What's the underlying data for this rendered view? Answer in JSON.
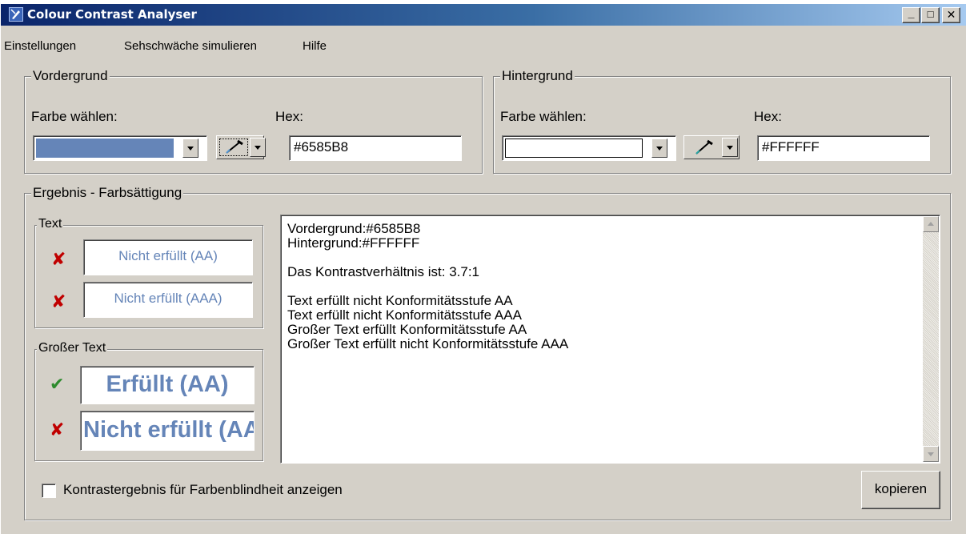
{
  "window": {
    "title": "Colour Contrast Analyser",
    "controls": {
      "minimize": "_",
      "maximize": "□",
      "close": "✕"
    }
  },
  "menu": [
    "Einstellungen",
    "Sehschwäche simulieren",
    "Hilfe"
  ],
  "foreground": {
    "group_label": "Vordergrund",
    "choose_label": "Farbe wählen:",
    "hex_label": "Hex:",
    "hex_value": "#6585B8",
    "swatch_color": "#6585b8",
    "picker_icon": "eyedropper-icon"
  },
  "background": {
    "group_label": "Hintergrund",
    "choose_label": "Farbe wählen:",
    "hex_label": "Hex:",
    "hex_value": "#FFFFFF",
    "swatch_color": "#ffffff",
    "picker_icon": "eyedropper-icon"
  },
  "result": {
    "group_label": "Ergebnis - Farbsättigung",
    "text_group": {
      "label": "Text",
      "items": [
        {
          "status": "fail",
          "icon": "cross-icon",
          "text": "Nicht erfüllt (AA)"
        },
        {
          "status": "fail",
          "icon": "cross-icon",
          "text": "Nicht erfüllt (AAA)"
        }
      ]
    },
    "large_text_group": {
      "label": "Großer Text",
      "items": [
        {
          "status": "pass",
          "icon": "checkmark-icon",
          "text": "Erfüllt (AA)"
        },
        {
          "status": "fail",
          "icon": "cross-icon",
          "text": "Nicht erfüllt (AAA)"
        }
      ]
    },
    "details": [
      "Vordergrund:#6585B8",
      "Hintergrund:#FFFFFF",
      "",
      "Das Kontrastverhältnis ist: 3.7:1",
      "",
      "Text erfüllt nicht Konformitätsstufe AA",
      "Text erfüllt nicht Konformitätsstufe AAA",
      "Großer Text erfüllt Konformitätsstufe AA",
      "Großer Text erfüllt nicht Konformitätsstufe AAA"
    ],
    "colorblind_checkbox_label": "Kontrastergebnis für Farbenblindheit anzeigen",
    "colorblind_checked": false,
    "copy_button": "kopieren"
  },
  "colors": {
    "pass": "#2e8b2e",
    "fail": "#c00000",
    "sample_text": "#6585b8"
  }
}
